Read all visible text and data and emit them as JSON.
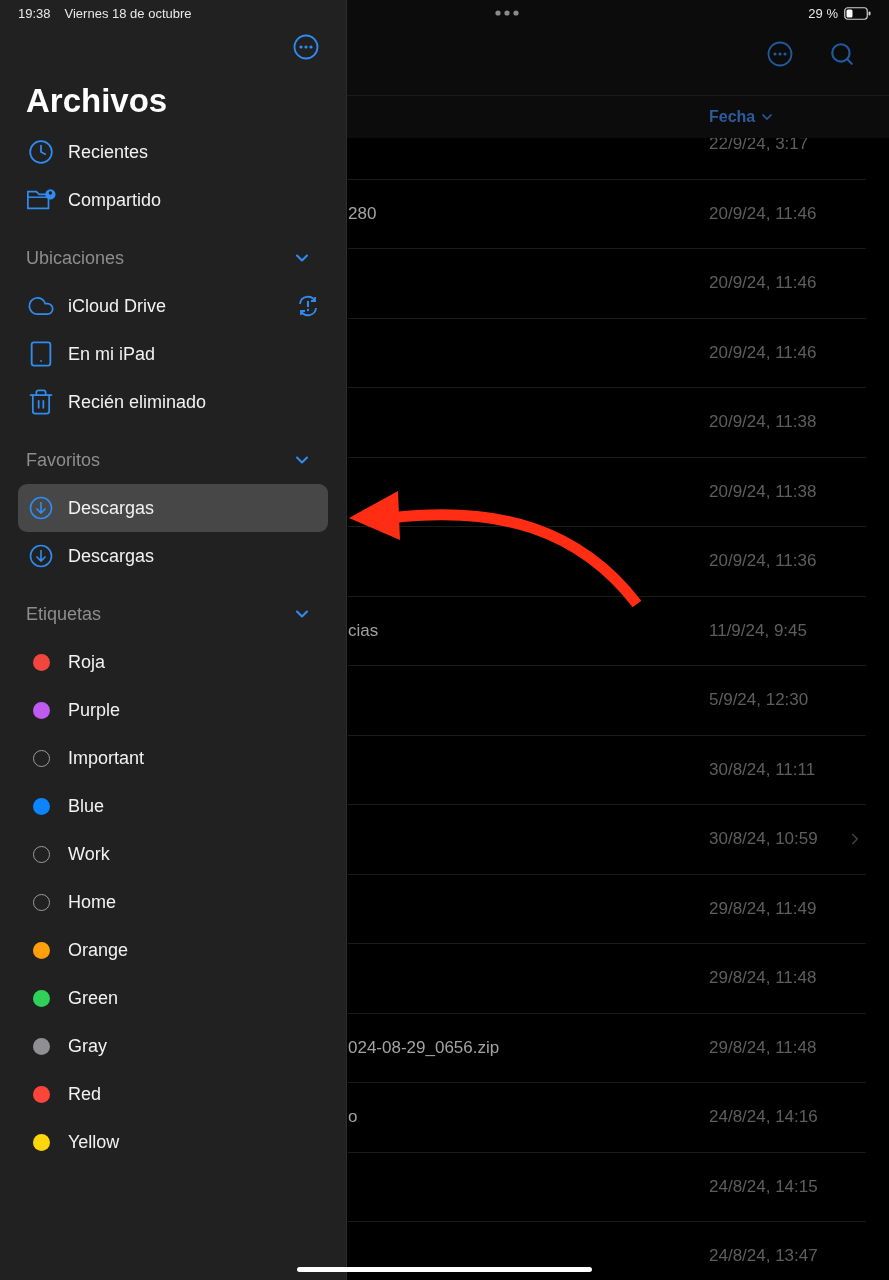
{
  "status_bar": {
    "time": "19:38",
    "date": "Viernes 18 de octubre",
    "battery": "29 %"
  },
  "sidebar": {
    "title": "Archivos",
    "items": [
      {
        "label": "Recientes",
        "kind": "recents",
        "selected": false
      },
      {
        "label": "Compartido",
        "kind": "shared",
        "selected": false
      }
    ],
    "sections": [
      {
        "title": "Ubicaciones",
        "expanded": true,
        "items": [
          {
            "label": "iCloud Drive",
            "kind": "cloud",
            "selected": false,
            "alert": true
          },
          {
            "label": "En mi iPad",
            "kind": "device",
            "selected": false
          },
          {
            "label": "Recién eliminado",
            "kind": "trash",
            "selected": false
          }
        ]
      },
      {
        "title": "Favoritos",
        "expanded": true,
        "items": [
          {
            "label": "Descargas",
            "kind": "download",
            "selected": true
          },
          {
            "label": "Descargas",
            "kind": "download",
            "selected": false
          }
        ]
      },
      {
        "title": "Etiquetas",
        "expanded": true,
        "items": [
          {
            "label": "Roja",
            "kind": "tag",
            "selected": false,
            "color": "#f2453d"
          },
          {
            "label": "Purple",
            "kind": "tag",
            "selected": false,
            "color": "#bf5af2"
          },
          {
            "label": "Important",
            "kind": "tag-outline",
            "selected": false
          },
          {
            "label": "Blue",
            "kind": "tag",
            "selected": false,
            "color": "#0a84ff"
          },
          {
            "label": "Work",
            "kind": "tag-outline",
            "selected": false
          },
          {
            "label": "Home",
            "kind": "tag-outline",
            "selected": false
          },
          {
            "label": "Orange",
            "kind": "tag",
            "selected": false,
            "color": "#ff9f0a"
          },
          {
            "label": "Green",
            "kind": "tag",
            "selected": false,
            "color": "#30d158"
          },
          {
            "label": "Gray",
            "kind": "tag",
            "selected": false,
            "color": "#8e8e93"
          },
          {
            "label": "Red",
            "kind": "tag",
            "selected": false,
            "color": "#ff453a"
          },
          {
            "label": "Yellow",
            "kind": "tag",
            "selected": false,
            "color": "#ffd60a"
          }
        ]
      }
    ]
  },
  "file_list": {
    "sort_column": "Fecha",
    "rows": [
      {
        "date": "22/9/24, 3:17"
      },
      {
        "name": "280",
        "date": "20/9/24, 11:46"
      },
      {
        "date": "20/9/24, 11:46"
      },
      {
        "date": "20/9/24, 11:46"
      },
      {
        "date": "20/9/24, 11:38"
      },
      {
        "date": "20/9/24, 11:38"
      },
      {
        "date": "20/9/24, 11:36"
      },
      {
        "name": "cias",
        "date": "11/9/24, 9:45"
      },
      {
        "date": "5/9/24, 12:30"
      },
      {
        "date": "30/8/24, 11:11"
      },
      {
        "date": "30/8/24, 10:59",
        "folder": true
      },
      {
        "date": "29/8/24, 11:49"
      },
      {
        "date": "29/8/24, 11:48"
      },
      {
        "name": "024-08-29_0656.zip",
        "date": "29/8/24, 11:48"
      },
      {
        "name": "o",
        "date": "24/8/24, 14:16"
      },
      {
        "date": "24/8/24, 14:15"
      },
      {
        "date": "24/8/24, 13:47"
      }
    ]
  }
}
